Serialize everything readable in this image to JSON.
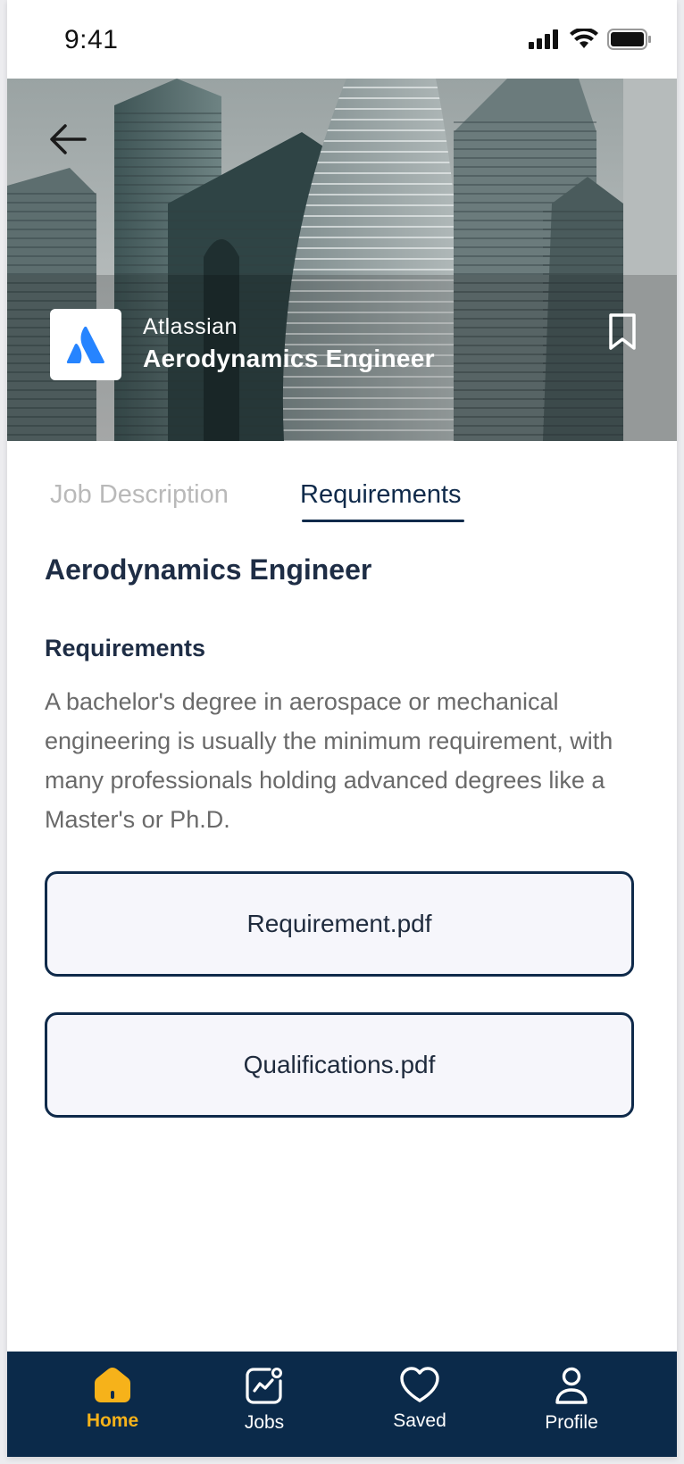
{
  "status_bar": {
    "time": "9:41"
  },
  "header": {
    "company": "Atlassian",
    "job_title": "Aerodynamics Engineer"
  },
  "tabs": [
    {
      "label": "Job Description",
      "active": false
    },
    {
      "label": "Requirements",
      "active": true
    }
  ],
  "content": {
    "title": "Aerodynamics Engineer",
    "section_title": "Requirements",
    "description": "A bachelor's degree in aerospace or mechanical engineering is usually the minimum requirement, with many professionals holding advanced degrees like a Master's or Ph.D."
  },
  "files": [
    {
      "name": "Requirement.pdf"
    },
    {
      "name": "Qualifications.pdf"
    }
  ],
  "bottom_nav": [
    {
      "label": "Home",
      "icon": "home-icon",
      "active": true
    },
    {
      "label": "Jobs",
      "icon": "jobs-icon",
      "active": false
    },
    {
      "label": "Saved",
      "icon": "heart-icon",
      "active": false
    },
    {
      "label": "Profile",
      "icon": "profile-icon",
      "active": false
    }
  ],
  "colors": {
    "primary": "#0b2a4a",
    "accent": "#f6b21a",
    "logo_blue": "#2684ff"
  }
}
